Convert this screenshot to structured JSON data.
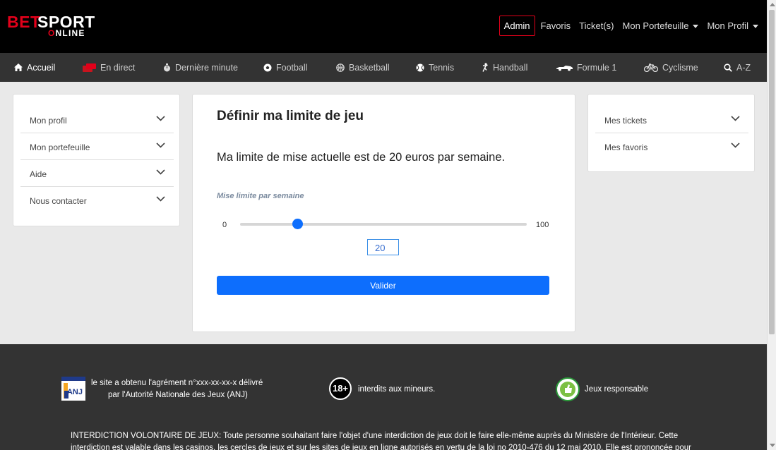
{
  "brand": {
    "bet": "BET",
    "sport": "SPORT",
    "online_prefix": "O",
    "online_rest": "NLINE"
  },
  "topnav": {
    "admin": "Admin",
    "favoris": "Favoris",
    "tickets": "Ticket(s)",
    "portefeuille": "Mon Portefeuille",
    "profil": "Mon Profil"
  },
  "sportsnav": [
    {
      "label": "Accueil",
      "icon": "home-icon"
    },
    {
      "label": "En direct",
      "icon": "live-icon"
    },
    {
      "label": "Dernière minute",
      "icon": "stopwatch-icon"
    },
    {
      "label": "Football",
      "icon": "football-icon"
    },
    {
      "label": "Basketball",
      "icon": "basketball-icon"
    },
    {
      "label": "Tennis",
      "icon": "tennis-icon"
    },
    {
      "label": "Handball",
      "icon": "handball-icon"
    },
    {
      "label": "Formule 1",
      "icon": "formula1-icon"
    },
    {
      "label": "Cyclisme",
      "icon": "bicycle-icon"
    },
    {
      "label": "A-Z",
      "icon": "search-icon"
    }
  ],
  "left_menu": [
    "Mon profil",
    "Mon portefeuille",
    "Aide",
    "Nous contacter"
  ],
  "right_menu": [
    "Mes tickets",
    "Mes favoris"
  ],
  "main": {
    "title": "Définir ma limite de jeu",
    "current_limit_text": "Ma limite de mise actuelle est de 20 euros par semaine.",
    "range_label": "Mise limite par semaine",
    "min": "0",
    "max": "100",
    "value": "20",
    "value_fraction": 0.2,
    "submit": "Valider"
  },
  "footer": {
    "anj_line1": "le site a obtenu l'agrément n°xxx-xx-xx-x délivré",
    "anj_line2": "par l'Autorité Nationale des Jeux (ANJ)",
    "anj_logo_text": "ANJ",
    "badge18": "18+",
    "minors": "interdits aux mineurs.",
    "responsible": "Jeux responsable",
    "disclaimer": "INTERDICTION VOLONTAIRE DE JEUX: Toute personne souhaitant faire l'objet d'une interdiction de jeux doit le faire elle-même auprès du Ministère de l'Intérieur. Cette interdiction est valable dans les casinos, les cercles de jeux et sur les sites de jeux en ligne autorisés en vertu de la loi no 2010-476 du 12 mai 2010. Elle est prononcée pour une"
  },
  "colors": {
    "accent": "#0d6efd",
    "brand_red": "#e2001a",
    "nav_bg": "#333333",
    "header_bg": "#000000"
  }
}
